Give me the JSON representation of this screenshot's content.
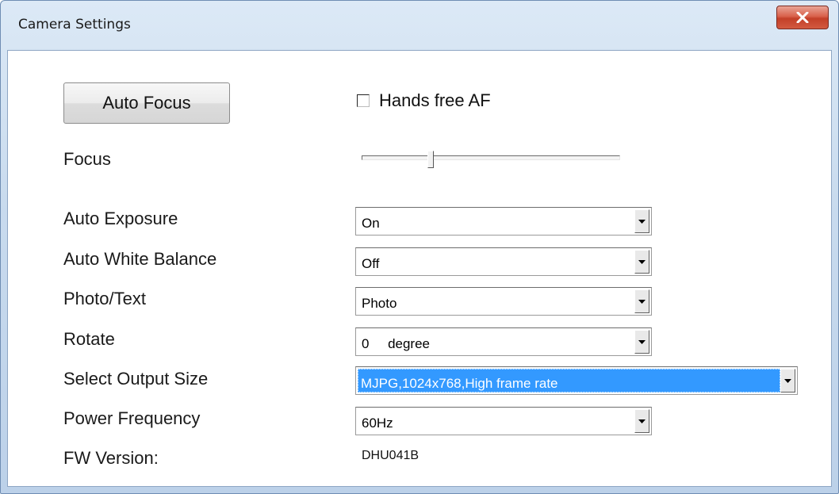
{
  "window": {
    "title": "Camera Settings",
    "close_icon": "close-x-icon"
  },
  "controls": {
    "auto_focus_label": "Auto Focus",
    "hands_free_label": "Hands free AF",
    "hands_free_checked": false
  },
  "focus": {
    "label": "Focus",
    "slider_fraction": 0.26
  },
  "settings": [
    {
      "label": "Auto Exposure",
      "value": "On"
    },
    {
      "label": "Auto White Balance",
      "value": "Off"
    },
    {
      "label": "Photo/Text",
      "value": "Photo"
    },
    {
      "label": "Rotate",
      "value": "0     degree"
    },
    {
      "label": "Select Output Size",
      "value": "MJPG,1024x768,High frame rate"
    },
    {
      "label": "Power Frequency",
      "value": "60Hz"
    }
  ],
  "firmware": {
    "label": "FW Version:",
    "value": "DHU041B"
  },
  "colors": {
    "selection": "#3399ff",
    "close_button": "#c9452c"
  }
}
